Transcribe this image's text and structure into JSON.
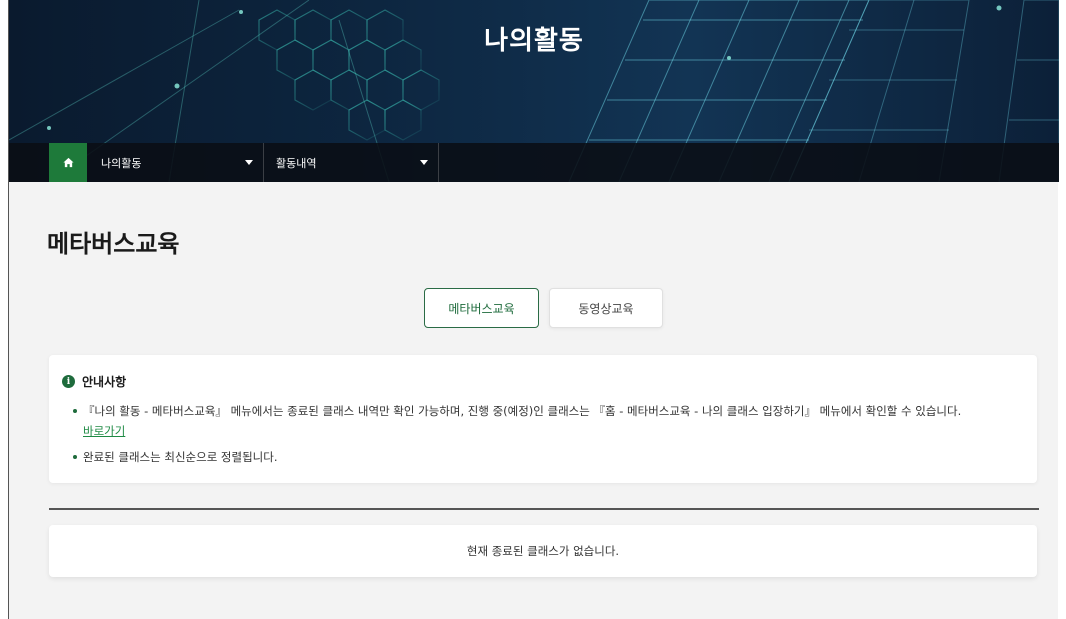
{
  "header": {
    "title": "나의활동"
  },
  "location": {
    "home_icon": "home-icon",
    "menu1": "나의활동",
    "menu2": "활동내역"
  },
  "page": {
    "title": "메타버스교육"
  },
  "tabs": [
    {
      "label": "메타버스교육",
      "active": true
    },
    {
      "label": "동영상교육",
      "active": false
    }
  ],
  "notice": {
    "icon": "info-icon",
    "title": "안내사항",
    "items": [
      "『나의 활동 - 메타버스교육』 메뉴에서는 종료된 클래스 내역만 확인 가능하며, 진행 중(예정)인 클래스는 『홈 - 메타버스교육 - 나의 클래스 입장하기』 메뉴에서 확인할 수 있습니다.",
      "완료된 클래스는 최신순으로 정렬됩니다."
    ],
    "link": "바로가기"
  },
  "empty_message": "현재 종료된 클래스가 없습니다.",
  "colors": {
    "accent": "#1e6b3c",
    "link": "#1e8a44",
    "home_button": "#1e7a3a"
  }
}
